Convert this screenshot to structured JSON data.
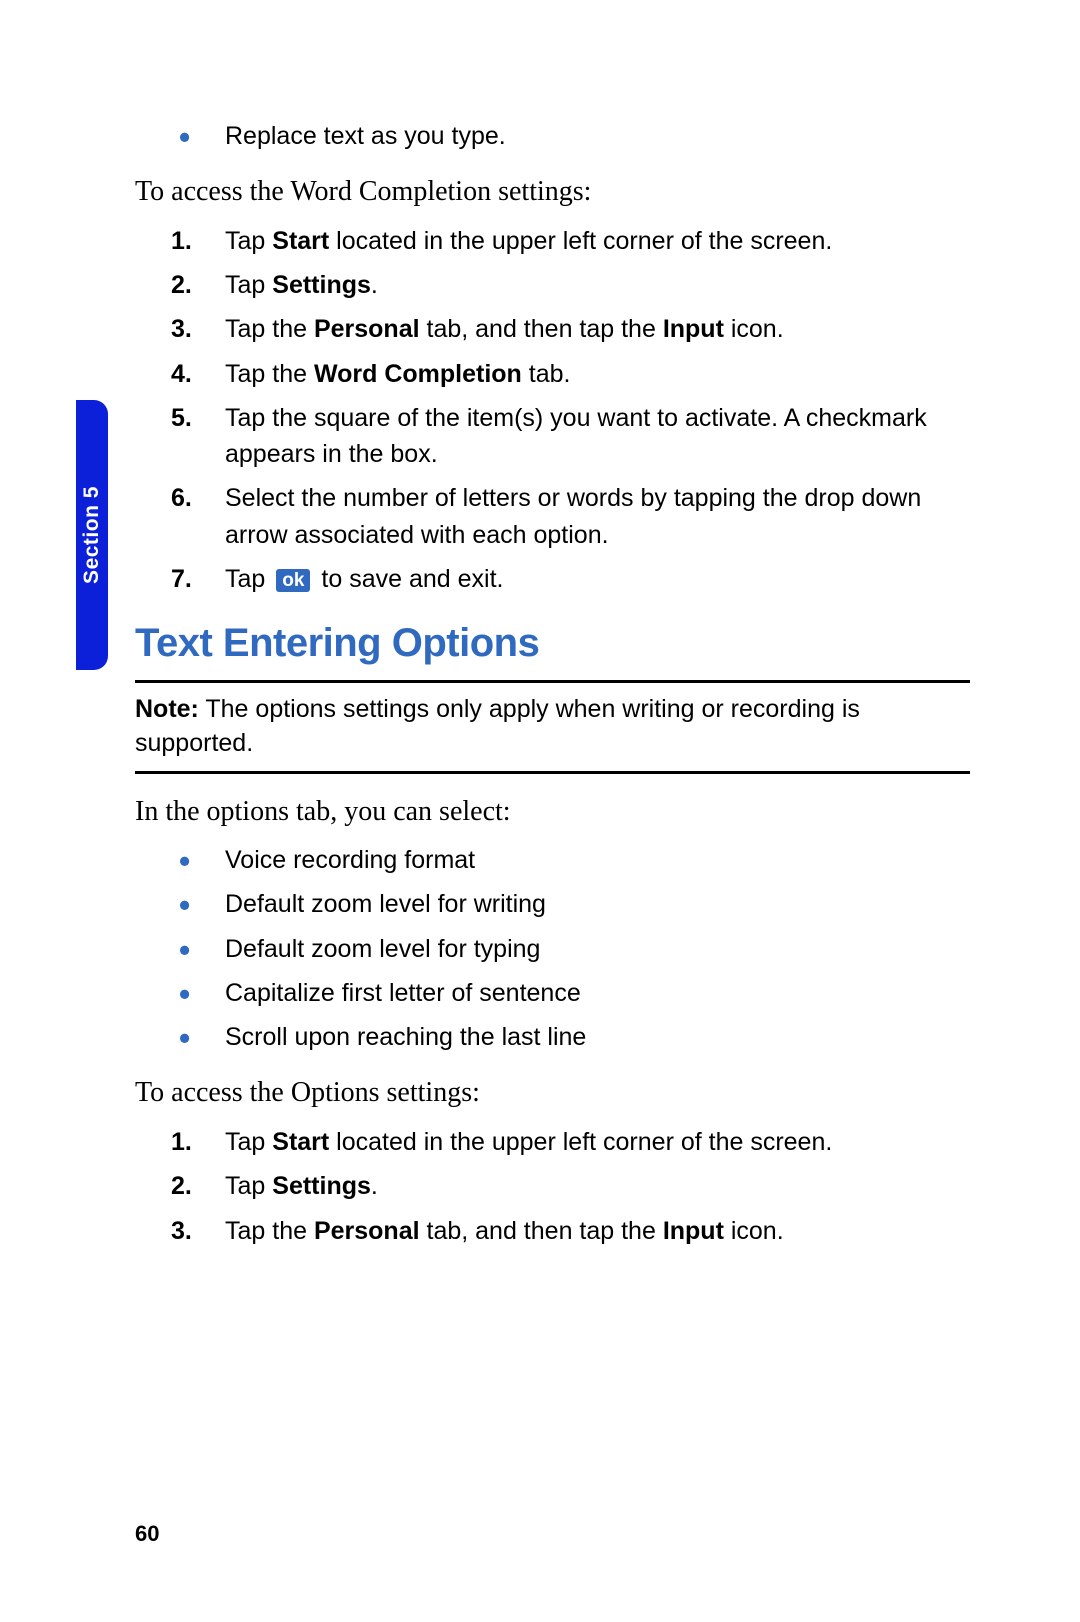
{
  "section_tab": "Section 5",
  "top_bullet": "Replace text as you type.",
  "intro1": "To access the Word Completion settings:",
  "steps1": [
    {
      "n": "1.",
      "pre": "Tap ",
      "b1": "Start",
      "rest": " located in the upper left corner of the screen."
    },
    {
      "n": "2.",
      "pre": "Tap ",
      "b1": "Settings",
      "rest": "."
    },
    {
      "n": "3.",
      "pre": "Tap the ",
      "b1": "Personal",
      "mid": " tab, and then tap the ",
      "b2": "Input",
      "rest": " icon."
    },
    {
      "n": "4.",
      "pre": "Tap the ",
      "b1": "Word Completion",
      "rest": " tab."
    },
    {
      "n": "5.",
      "text": "Tap the square of the item(s) you want to activate.  A checkmark appears in the box."
    },
    {
      "n": "6.",
      "text": "Select the number of letters or words by tapping the drop down arrow associated with each option."
    },
    {
      "n": "7.",
      "pre": "Tap ",
      "ok": "ok",
      "rest": " to save and exit."
    }
  ],
  "heading": "Text Entering Options",
  "note_label": "Note:",
  "note_text": " The options settings only apply when writing or recording is supported.",
  "intro2": "In the options tab, you can select:",
  "bullets2": [
    "Voice recording format",
    "Default zoom level for writing",
    "Default zoom level for typing",
    "Capitalize first letter of sentence",
    "Scroll upon reaching the last line"
  ],
  "intro3": "To access the Options settings:",
  "steps2": [
    {
      "n": "1.",
      "pre": "Tap ",
      "b1": "Start",
      "rest": " located in the upper left corner of the screen."
    },
    {
      "n": "2.",
      "pre": "Tap ",
      "b1": "Settings",
      "rest": "."
    },
    {
      "n": "3.",
      "pre": "Tap the ",
      "b1": "Personal",
      "mid": " tab, and then tap the ",
      "b2": "Input",
      "rest": " icon."
    }
  ],
  "page_number": "60"
}
